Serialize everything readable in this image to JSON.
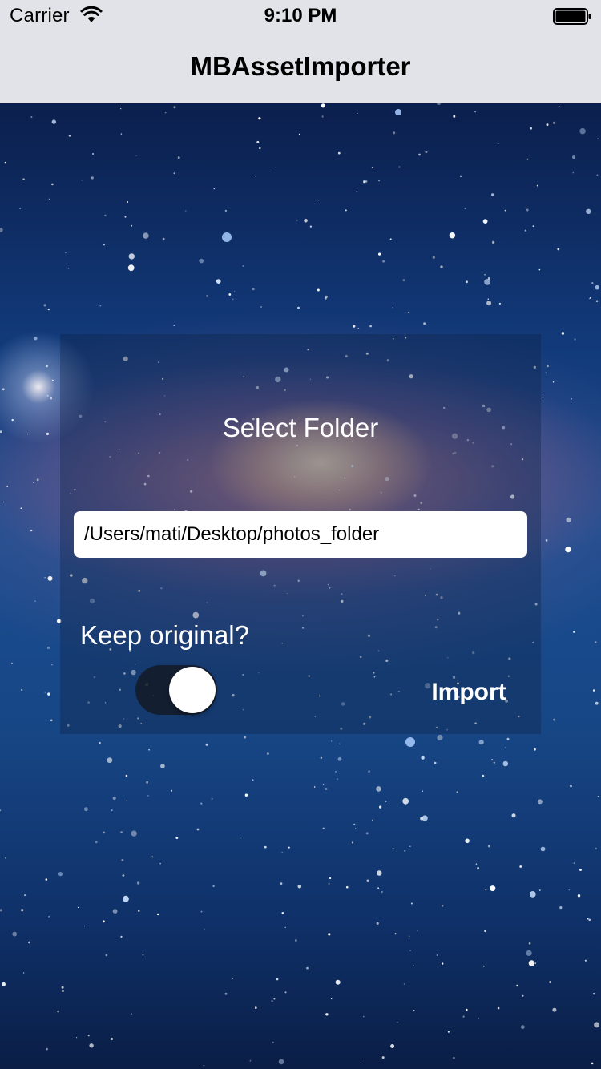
{
  "status_bar": {
    "carrier": "Carrier",
    "time": "9:10 PM",
    "wifi_icon": "wifi-icon",
    "battery_icon": "battery-icon"
  },
  "nav": {
    "title": "MBAssetImporter"
  },
  "form": {
    "heading": "Select Folder",
    "folder_path": "/Users/mati/Desktop/photos_folder",
    "keep_original_label": "Keep original?",
    "keep_original_on": false,
    "import_label": "Import"
  },
  "colors": {
    "bar_background": "#e2e3e8",
    "text_on_background": "#ffffff",
    "toggle_track": "#14191f"
  }
}
